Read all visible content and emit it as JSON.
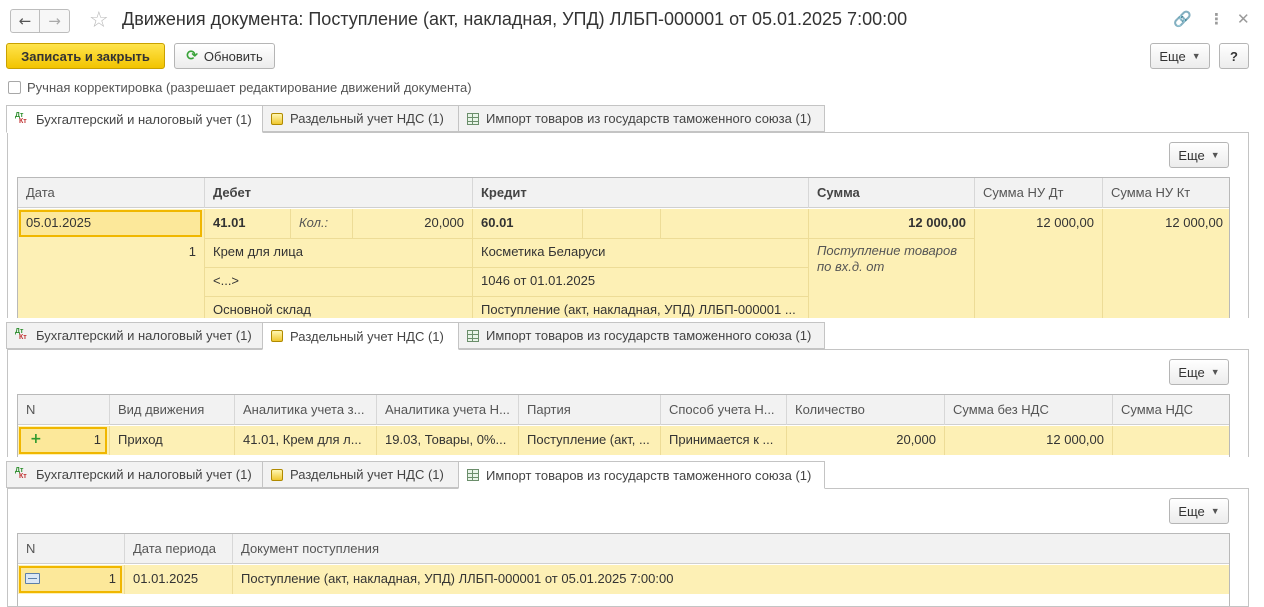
{
  "window": {
    "title": "Движения документа: Поступление (акт, накладная, УПД) ЛЛБП-000001 от 05.01.2025 7:00:00"
  },
  "toolbar": {
    "save_close": "Записать и закрыть",
    "refresh": "Обновить",
    "more": "Еще",
    "help": "?"
  },
  "manual_adjust": {
    "label": "Ручная корректировка (разрешает редактирование движений документа)",
    "checked": false
  },
  "tabs": [
    {
      "label": "Бухгалтерский и налоговый учет (1)",
      "icon": "dt-kt-icon"
    },
    {
      "label": "Раздельный учет НДС (1)",
      "icon": "register-icon"
    },
    {
      "label": "Импорт товаров из государств таможенного союза (1)",
      "icon": "table-icon"
    }
  ],
  "accounting": {
    "more": "Еще",
    "columns": [
      "Дата",
      "Дебет",
      "Кредит",
      "Сумма",
      "Сумма НУ Дт",
      "Сумма НУ Кт"
    ],
    "row": {
      "date": "05.01.2025",
      "line_no": "1",
      "debit_account": "41.01",
      "qty_label": "Кол.:",
      "qty": "20,000",
      "debit_sub1": "Крем для лица",
      "debit_sub2": "<...>",
      "debit_sub3": "Основной склад",
      "credit_account": "60.01",
      "credit_sub1": "Косметика Беларуси",
      "credit_sub2": "1046 от 01.01.2025",
      "credit_sub3": "Поступление (акт, накладная, УПД) ЛЛБП-000001 ...",
      "amount": "12 000,00",
      "content": "Поступление товаров по вх.д. от",
      "amount_nu_dt": "12 000,00",
      "amount_nu_kt": "12 000,00"
    }
  },
  "vat": {
    "more": "Еще",
    "columns": [
      "N",
      "Вид движения",
      "Аналитика учета з...",
      "Аналитика учета Н...",
      "Партия",
      "Способ учета Н...",
      "Количество",
      "Сумма без НДС",
      "Сумма НДС"
    ],
    "row": {
      "n": "1",
      "movement": "Приход",
      "analytics1": "41.01, Крем для л...",
      "analytics2": "19.03, Товары, 0%...",
      "batch": "Поступление (акт, ...",
      "method": "Принимается к ...",
      "qty": "20,000",
      "amount": "12 000,00",
      "vat": ""
    }
  },
  "import": {
    "more": "Еще",
    "columns": [
      "N",
      "Дата периода",
      "Документ поступления"
    ],
    "row": {
      "n": "1",
      "period": "01.01.2025",
      "document": "Поступление (акт, накладная, УПД) ЛЛБП-000001 от 05.01.2025 7:00:00"
    }
  },
  "colors": {
    "accent_yellow": "#f2c400",
    "row_highlight": "#fdf0b5",
    "selected_cell": "#f0b700"
  }
}
